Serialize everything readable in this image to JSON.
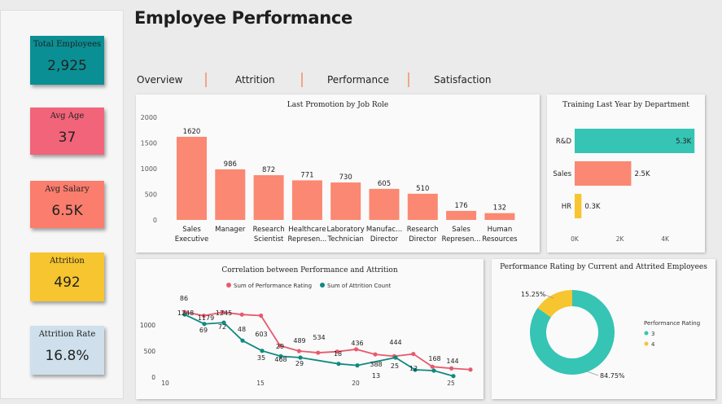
{
  "title": "Employee Performance",
  "kpis": [
    {
      "label": "Total Employees",
      "value": "2,925",
      "color": "#0a8f94"
    },
    {
      "label": "Avg Age",
      "value": "37",
      "color": "#f2647a"
    },
    {
      "label": "Avg Salary",
      "value": "6.5K",
      "color": "#fb7d6d"
    },
    {
      "label": "Attrition",
      "value": "492",
      "color": "#f6c52f"
    },
    {
      "label": "Attrition Rate",
      "value": "16.8%",
      "color": "#cfe0ec"
    }
  ],
  "tabs": [
    "Overview",
    "Attrition",
    "Performance",
    "Satisfaction"
  ],
  "colors": {
    "salmon": "#fb8872",
    "teal": "#36c4b4",
    "yellow": "#f6c52f",
    "pink": "#e8596e",
    "dark_teal": "#0f8a80"
  },
  "chart_data": [
    {
      "type": "bar",
      "title": "Last Promotion by Job Role",
      "categories": [
        "Sales Executive",
        "Manager",
        "Research Scientist",
        "Healthcare Represen...",
        "Laboratory Technician",
        "Manufac... Director",
        "Research Director",
        "Sales Represen...",
        "Human Resources"
      ],
      "category_lines": [
        [
          "Sales",
          "Executive"
        ],
        [
          "Manager"
        ],
        [
          "Research",
          "Scientist"
        ],
        [
          "Healthcare",
          "Represen..."
        ],
        [
          "Laboratory",
          "Technician"
        ],
        [
          "Manufac...",
          "Director"
        ],
        [
          "Research",
          "Director"
        ],
        [
          "Sales",
          "Represen..."
        ],
        [
          "Human",
          "Resources"
        ]
      ],
      "values": [
        1620,
        986,
        872,
        771,
        730,
        605,
        510,
        176,
        132
      ],
      "value_labels": [
        "1620",
        "986",
        "872",
        "771",
        "730",
        "605",
        "510",
        "176",
        "132"
      ],
      "ylim": [
        0,
        2000
      ],
      "yticks": [
        "0",
        "500",
        "1000",
        "1500",
        "2000"
      ]
    },
    {
      "type": "bar",
      "orientation": "horizontal",
      "title": "Training Last Year by Department",
      "categories": [
        "R&D",
        "Sales",
        "HR"
      ],
      "values": [
        5300,
        2500,
        300
      ],
      "value_labels": [
        "5.3K",
        "2.5K",
        "0.3K"
      ],
      "bar_colors": [
        "#36c4b4",
        "#fb8872",
        "#f6c52f"
      ],
      "xlim": [
        0,
        5400
      ],
      "xticks": [
        "0K",
        "2K",
        "4K"
      ]
    },
    {
      "type": "line",
      "title": "Correlation between Performance and Attrition",
      "legend_position": "top",
      "x": [
        10,
        11,
        12,
        13,
        14,
        15,
        16,
        17,
        18,
        19,
        20,
        21,
        22,
        23,
        24,
        25
      ],
      "xticks": [
        "10",
        "15",
        "20",
        "25"
      ],
      "ylim": [
        0,
        1500
      ],
      "yticks": [
        "0",
        "500",
        "1000"
      ],
      "series": [
        {
          "name": "Sum of Performance Rating",
          "color": "#e8596e",
          "values": [
            1248,
            1179,
            1245,
            1200,
            1180,
            603,
            500,
            468,
            489,
            534,
            436,
            400,
            444,
            200,
            168,
            144
          ],
          "labels": [
            "1248",
            "1179",
            "1245",
            "",
            "",
            "603",
            "",
            "468",
            "489",
            "534",
            "436",
            "",
            "444",
            "",
            "168",
            "144"
          ]
        },
        {
          "name": "Sum of Attrition Count",
          "color": "#0f8a80",
          "values": [
            86,
            69,
            72,
            48,
            35,
            29,
            29,
            18,
            13,
            25,
            12
          ],
          "display_values": [
            1200,
            1020,
            1045,
            700,
            505,
            400,
            375,
            255,
            225,
            375,
            140,
            125,
            20
          ],
          "labels": [
            "86",
            "69",
            "72",
            "48",
            "35",
            "29",
            "29",
            "18",
            "13",
            "25",
            "12"
          ]
        }
      ]
    },
    {
      "type": "pie",
      "title": "Performance Rating by Current and Attrited Employees",
      "legend_title": "Performance Rating",
      "slices": [
        {
          "label": "3",
          "value": 84.75,
          "value_label": "84.75%",
          "color": "#36c4b4"
        },
        {
          "label": "4",
          "value": 15.25,
          "value_label": "15.25%",
          "color": "#f6c52f"
        }
      ]
    }
  ]
}
